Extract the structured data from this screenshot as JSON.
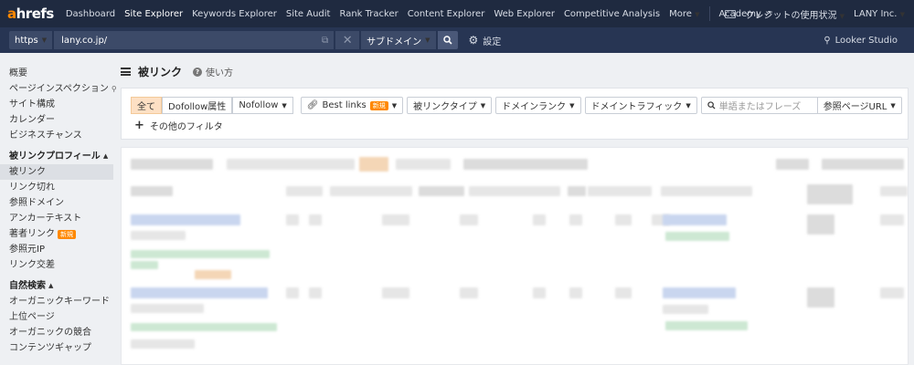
{
  "nav": {
    "logo_a": "a",
    "logo_rest": "hrefs",
    "items": [
      "Dashboard",
      "Site Explorer",
      "Keywords Explorer",
      "Site Audit",
      "Rank Tracker",
      "Content Explorer",
      "Web Explorer",
      "Competitive Analysis",
      "More"
    ],
    "active": "Site Explorer",
    "academy": "Academy",
    "credit": "クレジットの使用状況",
    "account": "LANY Inc."
  },
  "urlbar": {
    "protocol": "https",
    "url": "lany.co.jp/",
    "mode": "サブドメイン",
    "settings": "設定",
    "looker": "Looker Studio"
  },
  "sidebar": {
    "top_items": [
      "概要",
      "ページインスペクション",
      "サイト構成",
      "カレンダー",
      "ビジネスチャンス"
    ],
    "backlink_section": {
      "title": "被リンクプロフィール",
      "items": [
        {
          "label": "被リンク",
          "active": true
        },
        {
          "label": "リンク切れ"
        },
        {
          "label": "参照ドメイン"
        },
        {
          "label": "アンカーテキスト"
        },
        {
          "label": "著者リンク",
          "badge": "新規"
        },
        {
          "label": "参照元IP"
        },
        {
          "label": "リンク交差"
        }
      ]
    },
    "organic_section": {
      "title": "自然検索",
      "items": [
        "オーガニックキーワード",
        "上位ページ",
        "オーガニックの競合",
        "コンテンツギャップ"
      ]
    }
  },
  "main": {
    "title": "被リンク",
    "howto": "使い方",
    "filters": {
      "seg_all": "全て",
      "seg_dofollow": "Dofollow属性",
      "nofollow": "Nofollow",
      "best_links": "Best links",
      "best_links_badge": "新規",
      "link_type": "被リンクタイプ",
      "domain_rank": "ドメインランク",
      "domain_traffic": "ドメイントラフィック",
      "search_placeholder": "単語またはフレーズ",
      "ref_page_url": "参照ページURL",
      "more_filters": "その他のフィルタ"
    }
  },
  "colors": {
    "nav_bg": "#1f2a40",
    "urlbar_bg": "#273553",
    "accent": "#ff8800",
    "selected_seg": "#fde0c4"
  }
}
